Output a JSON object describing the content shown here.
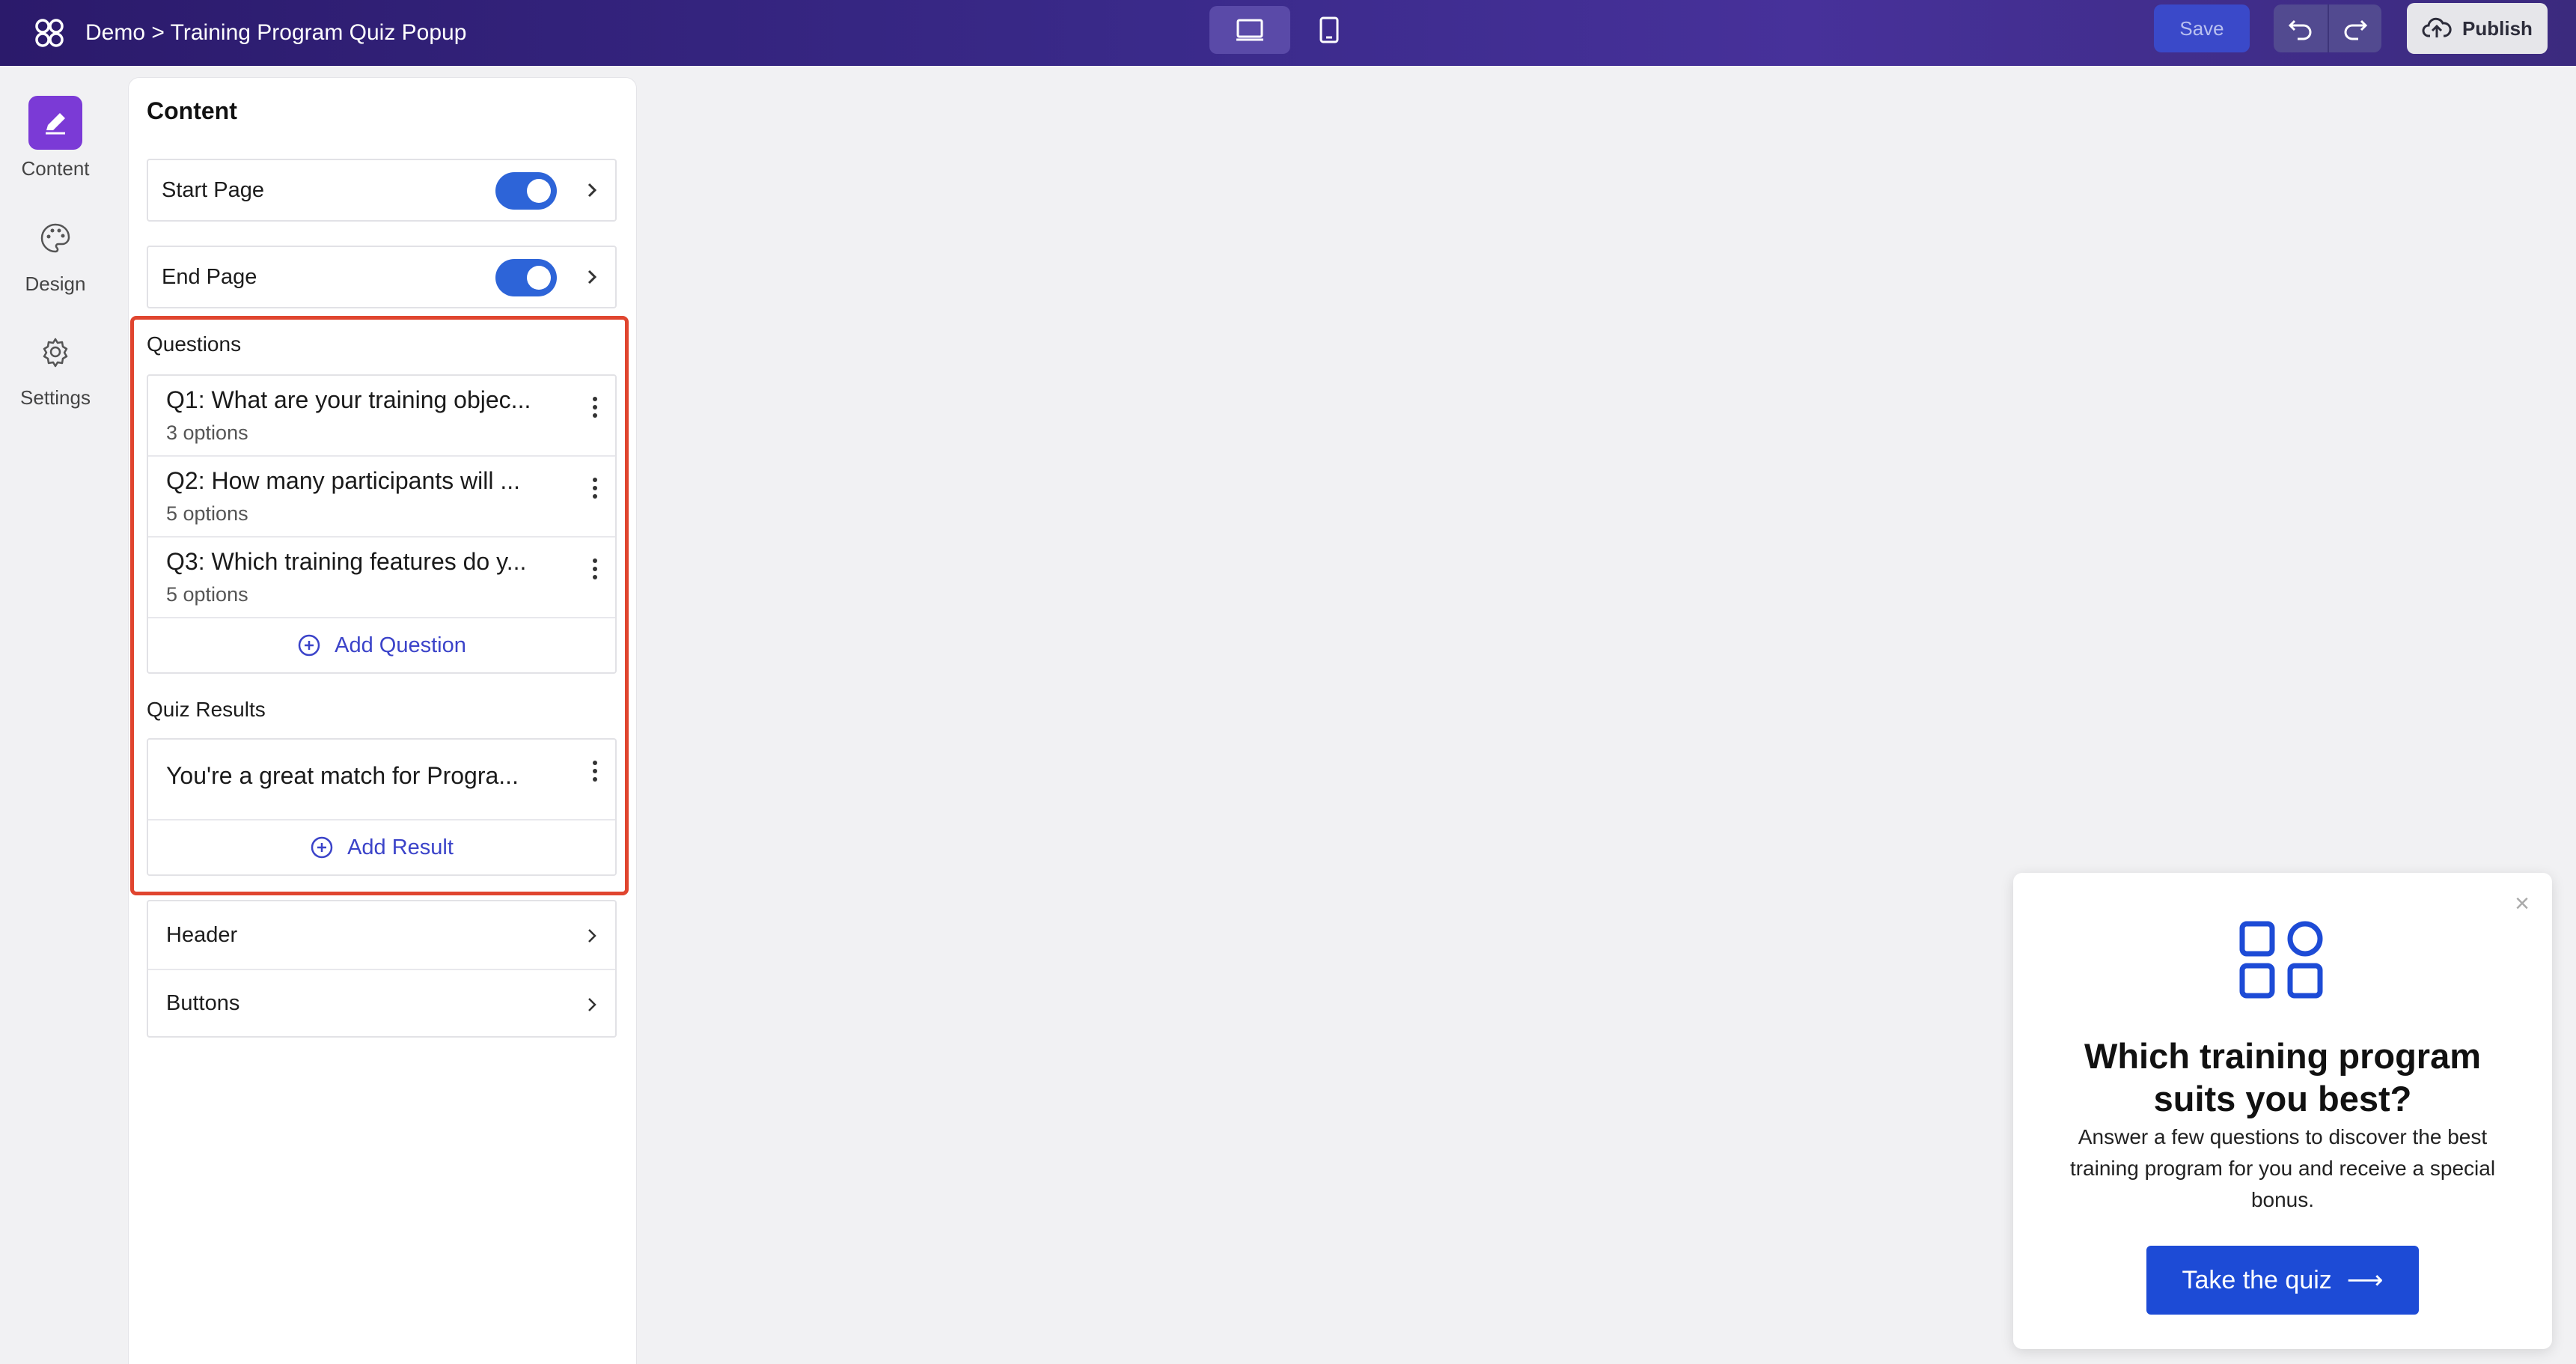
{
  "topbar": {
    "breadcrumb": "Demo > Training Program Quiz Popup",
    "save_label": "Save",
    "publish_label": "Publish"
  },
  "rail": {
    "items": [
      {
        "label": "Content",
        "icon": "pencil-icon",
        "active": true
      },
      {
        "label": "Design",
        "icon": "palette-icon",
        "active": false
      },
      {
        "label": "Settings",
        "icon": "gear-icon",
        "active": false
      }
    ]
  },
  "panel": {
    "title": "Content",
    "start_page": {
      "label": "Start Page",
      "enabled": true
    },
    "end_page": {
      "label": "End Page",
      "enabled": true
    },
    "questions_label": "Questions",
    "questions": [
      {
        "title": "Q1: What are your training objec...",
        "sub": "3 options"
      },
      {
        "title": "Q2: How many participants will ...",
        "sub": "5 options"
      },
      {
        "title": "Q3: Which training features do y...",
        "sub": "5 options"
      }
    ],
    "add_question_label": "Add Question",
    "results_label": "Quiz Results",
    "results": [
      {
        "title": "You're a great match for Progra..."
      }
    ],
    "add_result_label": "Add Result",
    "nav": [
      {
        "label": "Header"
      },
      {
        "label": "Buttons"
      }
    ]
  },
  "popup": {
    "close": "×",
    "title": "Which training program suits you best?",
    "body": "Answer a few questions to discover the best training program for you and receive a special bonus.",
    "cta_label": "Take the quiz",
    "cta_arrow": "⟶"
  },
  "colors": {
    "accent": "#2d64d8",
    "rail_active": "#7b3ad6",
    "highlight": "#e0452f",
    "link": "#3b43c9",
    "cta": "#1d4bd6"
  }
}
